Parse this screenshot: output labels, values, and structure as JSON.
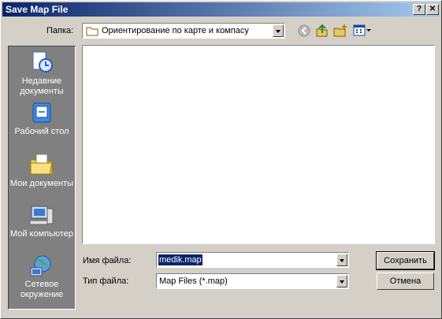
{
  "window": {
    "title": "Save Map File",
    "help_btn": "?",
    "close_btn": "✕"
  },
  "location": {
    "label": "Папка:",
    "value": "Ориентирование по карте и компасу"
  },
  "toolbar_icons": [
    "back-icon",
    "up-folder-icon",
    "new-folder-icon",
    "view-menu-icon"
  ],
  "places": [
    {
      "label": "Недавние документы",
      "icon": "recent-documents-icon"
    },
    {
      "label": "Рабочий стол",
      "icon": "desktop-icon"
    },
    {
      "label": "Мои документы",
      "icon": "my-documents-icon"
    },
    {
      "label": "Мой компьютер",
      "icon": "my-computer-icon"
    },
    {
      "label": "Сетевое окружение",
      "icon": "network-icon"
    }
  ],
  "filename": {
    "label": "Имя файла:",
    "value": "medik.map"
  },
  "filetype": {
    "label": "Тип файла:",
    "value": "Map Files (*.map)"
  },
  "buttons": {
    "save": "Сохранить",
    "cancel": "Отмена"
  }
}
